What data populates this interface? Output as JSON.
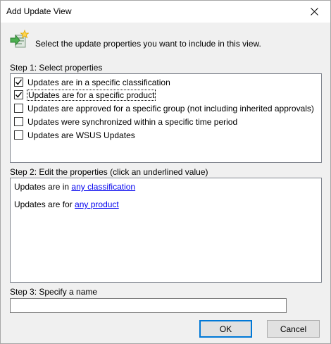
{
  "window": {
    "title": "Add Update View"
  },
  "header": {
    "icon": "add-view-wizard-icon",
    "instruction": "Select the update properties you want to include in this view."
  },
  "step1": {
    "label": "Step 1: Select properties",
    "items": [
      {
        "label": "Updates are in a specific classification",
        "checked": true
      },
      {
        "label": "Updates are for a specific product",
        "checked": true
      },
      {
        "label": "Updates are approved for a specific group (not including inherited approvals)",
        "checked": false
      },
      {
        "label": "Updates were synchronized within a specific time period",
        "checked": false
      },
      {
        "label": "Updates are WSUS Updates",
        "checked": false
      }
    ]
  },
  "step2": {
    "label": "Step 2: Edit the properties (click an underlined value)",
    "lines": [
      {
        "prefix": "Updates are in ",
        "link": "any classification"
      },
      {
        "prefix": "Updates are for ",
        "link": "any product"
      }
    ]
  },
  "step3": {
    "label": "Step 3: Specify a name",
    "name_value": ""
  },
  "buttons": {
    "ok": "OK",
    "cancel": "Cancel"
  },
  "colors": {
    "link": "#0000ee",
    "default_button_border": "#0078d7",
    "dialog_background": "#f0f0f0"
  }
}
